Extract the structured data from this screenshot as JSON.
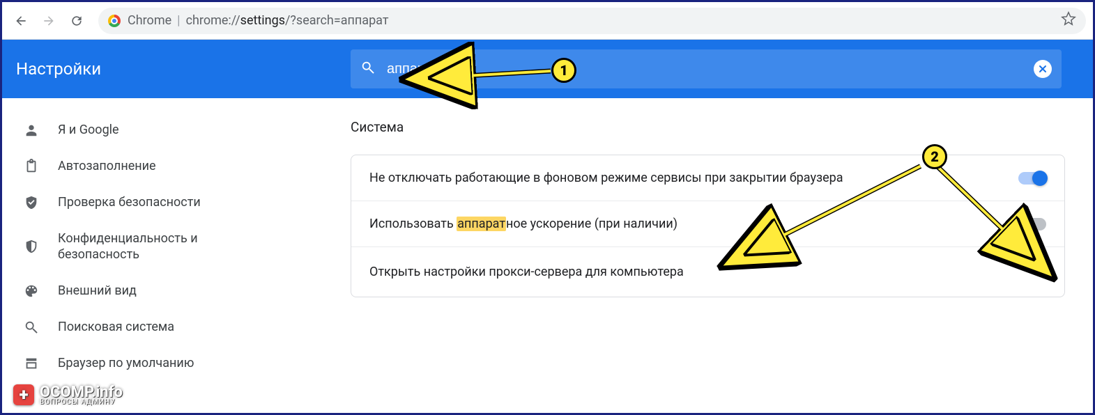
{
  "browser": {
    "label": "Chrome",
    "url_display_prefix": "chrome://",
    "url_display_bold": "settings",
    "url_display_suffix": "/?search=аппарат"
  },
  "header": {
    "title": "Настройки",
    "search_value": "аппарат"
  },
  "sidebar": {
    "items": [
      {
        "label": "Я и Google",
        "icon": "person-icon"
      },
      {
        "label": "Автозаполнение",
        "icon": "clipboard-icon"
      },
      {
        "label": "Проверка безопасности",
        "icon": "shield-check-icon"
      },
      {
        "label": "Конфиденциальность и безопасность",
        "icon": "shield-half-icon"
      },
      {
        "label": "Внешний вид",
        "icon": "palette-icon"
      },
      {
        "label": "Поисковая система",
        "icon": "search-icon"
      },
      {
        "label": "Браузер по умолчанию",
        "icon": "browser-icon"
      }
    ]
  },
  "section": {
    "title": "Система",
    "rows": [
      {
        "label_pre": "Не отключать работающие в фоновом режиме сервисы при закрытии браузера",
        "highlight": "",
        "label_post": "",
        "toggle": "on"
      },
      {
        "label_pre": "Использовать ",
        "highlight": "аппарат",
        "label_post": "ное ускорение (при наличии)",
        "toggle": "off"
      },
      {
        "label_pre": "Открыть настройки прокси-сервера для компьютера",
        "highlight": "",
        "label_post": "",
        "link": true
      }
    ]
  },
  "annotations": {
    "badge1": "1",
    "badge2": "2"
  },
  "watermark": {
    "text": "OCOMP.info",
    "sub": "ВОПРОСЫ АДМИНУ"
  }
}
